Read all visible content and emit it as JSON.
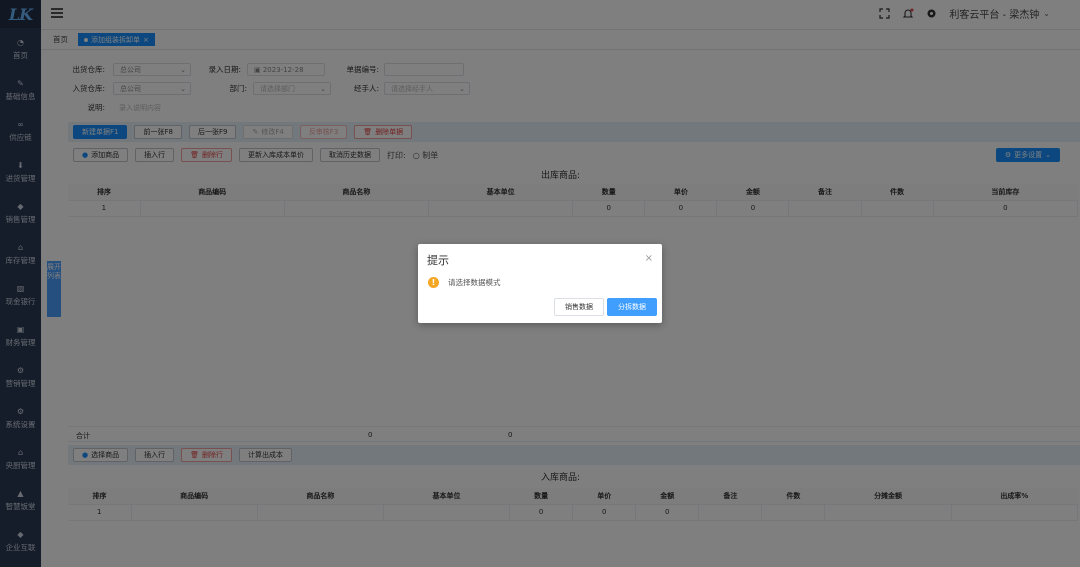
{
  "sidebar": {
    "logo": "LK",
    "items": [
      {
        "label": "首页",
        "icon": "dashboard-icon"
      },
      {
        "label": "基础信息",
        "icon": "edit-icon"
      },
      {
        "label": "供应链",
        "icon": "link-icon"
      },
      {
        "label": "进货管理",
        "icon": "download-icon"
      },
      {
        "label": "销售管理",
        "icon": "tag-icon"
      },
      {
        "label": "库存管理",
        "icon": "warehouse-icon"
      },
      {
        "label": "现金银行",
        "icon": "chart-icon"
      },
      {
        "label": "财务管理",
        "icon": "wallet-icon"
      },
      {
        "label": "营销管理",
        "icon": "gear-icon"
      },
      {
        "label": "系统设置",
        "icon": "gear-icon"
      },
      {
        "label": "央厨管理",
        "icon": "home-icon"
      },
      {
        "label": "智慧饭堂",
        "icon": "building-icon"
      },
      {
        "label": "企业互联",
        "icon": "tag-icon"
      }
    ]
  },
  "header": {
    "user": "利客云平台 - 梁杰钟"
  },
  "tabs": {
    "home": "首页",
    "active": "添加组装拆卸单"
  },
  "form": {
    "out_wh_label": "出货仓库:",
    "out_wh_value": "总公司",
    "date_label": "录入日期:",
    "date_value": "2023-12-28",
    "doc_no_label": "单据编号:",
    "doc_no_value": "",
    "in_wh_label": "入货仓库:",
    "in_wh_value": "总公司",
    "dept_label": "部门:",
    "dept_placeholder": "请选择部门",
    "handler_label": "经手人:",
    "handler_placeholder": "请选择经手人",
    "remark_label": "说明:",
    "remark_placeholder": "录入说明内容"
  },
  "toolbar1": {
    "new": "新建单据F1",
    "prev": "前一张F8",
    "next": "后一张F9",
    "modify": "修改F4",
    "reverse": "反审核F3",
    "delete": "删除单据"
  },
  "toolbar2": {
    "add_goods": "添加商品",
    "insert_row": "插入行",
    "delete_row": "删除行",
    "update_cost": "更新入库成本单价",
    "fetch_history": "取消历史数据",
    "print_label": "打印:",
    "print_value": "制单",
    "more": "更多设置"
  },
  "out_section": {
    "title": "出库商品:",
    "headers": [
      "排序",
      "商品编码",
      "商品名称",
      "基本单位",
      "数量",
      "单价",
      "金额",
      "备注",
      "件数",
      "当前库存"
    ],
    "row": [
      "1",
      "",
      "",
      "",
      "0",
      "0",
      "0",
      "",
      "",
      "0"
    ]
  },
  "side_tab": "展开列表",
  "sum": {
    "label": "合计",
    "qty": "0",
    "amount": "0"
  },
  "toolbar3": {
    "select_goods": "选择商品",
    "insert_row": "插入行",
    "delete_row": "删除行",
    "calc_cost": "计算出成本"
  },
  "in_section": {
    "title": "入库商品:",
    "headers": [
      "排序",
      "商品编码",
      "商品名称",
      "基本单位",
      "数量",
      "单价",
      "金额",
      "备注",
      "件数",
      "分摊金额",
      "出成率%"
    ],
    "row": [
      "1",
      "",
      "",
      "",
      "0",
      "0",
      "0",
      "",
      "",
      "",
      ""
    ]
  },
  "dialog": {
    "title": "提示",
    "message": "请选择数据模式",
    "btn_sales": "销售数据",
    "btn_split": "分拆数据"
  }
}
